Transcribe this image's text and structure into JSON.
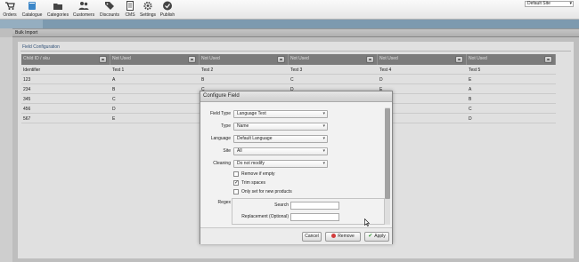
{
  "nav": {
    "items": [
      {
        "label": "Orders",
        "icon": "cart-icon"
      },
      {
        "label": "Catalogue",
        "icon": "book-icon"
      },
      {
        "label": "Categories",
        "icon": "folder-icon"
      },
      {
        "label": "Customers",
        "icon": "users-icon"
      },
      {
        "label": "Discounts",
        "icon": "tag-icon"
      },
      {
        "label": "CMS",
        "icon": "document-icon"
      },
      {
        "label": "Settings",
        "icon": "gear-icon"
      },
      {
        "label": "Publish",
        "icon": "check-circle-icon"
      }
    ],
    "site_select": "Default Site"
  },
  "page": {
    "title": "Bulk Import",
    "legend": "Field Configuration"
  },
  "grid": {
    "columns": [
      {
        "header": "Child ID / sku",
        "sub": "Identifier"
      },
      {
        "header": "Not Used",
        "sub": "Test 1"
      },
      {
        "header": "Not Used",
        "sub": "Test 2"
      },
      {
        "header": "Not Used",
        "sub": "Test 3"
      },
      {
        "header": "Not Used",
        "sub": "Test 4"
      },
      {
        "header": "Not Used",
        "sub": "Test 5"
      }
    ],
    "rows": [
      [
        "123",
        "A",
        "B",
        "C",
        "D",
        "E"
      ],
      [
        "234",
        "B",
        "C",
        "D",
        "E",
        "A"
      ],
      [
        "345",
        "C",
        "",
        "",
        "",
        "B"
      ],
      [
        "456",
        "D",
        "",
        "",
        "",
        "C"
      ],
      [
        "567",
        "E",
        "",
        "",
        "",
        "D"
      ]
    ]
  },
  "dialog": {
    "title": "Configure Field",
    "fields": {
      "field_type": {
        "label": "Field Type",
        "value": "Language Text"
      },
      "type": {
        "label": "Type",
        "value": "Name"
      },
      "language": {
        "label": "Language",
        "value": "Default Language"
      },
      "site": {
        "label": "Site",
        "value": "All"
      },
      "cleaning": {
        "label": "Cleaning",
        "value": "Do not modify"
      }
    },
    "checkboxes": {
      "remove_if_empty": {
        "label": "Remove if empty",
        "checked": false
      },
      "trim_spaces": {
        "label": "Trim spaces",
        "checked": true
      },
      "only_new": {
        "label": "Only set for new products",
        "checked": false
      }
    },
    "regex": {
      "label": "Regex",
      "search_label": "Search",
      "search_value": "",
      "replacement_label": "Replacement (Optional)",
      "replacement_value": ""
    },
    "buttons": {
      "cancel": "Cancel",
      "remove": "Remove",
      "apply": "Apply"
    }
  },
  "colors": {
    "header_bg": "#8c8c8c",
    "strip_blue": "#8fb0c8",
    "legend_blue": "#3a5f8a",
    "remove_red": "#d23c3c",
    "apply_green": "#3a9a3a"
  }
}
